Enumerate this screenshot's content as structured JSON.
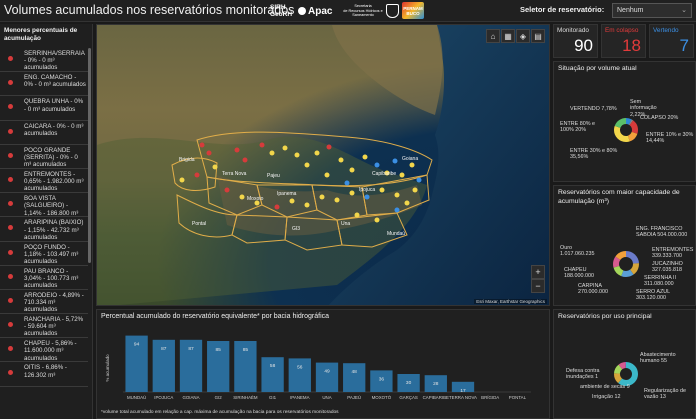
{
  "header": {
    "title": "Volumes acumulados nos reservatórios monitorados",
    "logo_sirh": [
      "SIRH",
      "GeoRH"
    ],
    "logo_apac": "Apac",
    "logo_sec": [
      "Secretaria",
      "de Recursos Hídricos e",
      "Saneamento"
    ],
    "logo_gov": [
      "PERNAM",
      "BUCO"
    ],
    "selector_label": "Seletor de reservatório:",
    "selector_value": "Nenhum"
  },
  "left_panel": {
    "title": "Menores percentuais de acumulação",
    "items": [
      "SERRINHA/SERRAIA - 0% - 0 m³ acumulados",
      "ENG. CAMACHO - 0% - 0 m³ acumulados",
      "QUEBRA UNHA - 0% - 0 m³ acumulados",
      "CAICARA - 0% - 0 m³ acumulados",
      "POCO GRANDE (SERRITA) - 0% - 0 m³ acumulados",
      "ENTREMONTES - 0,65% - 1.982.000 m³ acumulados",
      "BOA VISTA (SALGUEIRO) - 1,14% - 186.800 m³ acumulados",
      "ARARIPINA (BAIXIO) - 1,15% - 42.732 m³ acumulados",
      "POÇO FUNDO - 1,18% - 103.497 m³ acumulados",
      "PAU BRANCO - 3,04% - 100.773 m³ acumulados",
      "ARRODEIO - 4,89% - 710.334 m³ acumulados",
      "RANCHARIA - 5,72% - 59.604 m³ acumulados",
      "CHAPEU - 5,86% - 11.600.000 m³ acumulados",
      "OITIS - 6,86% - 126.302 m³"
    ]
  },
  "map": {
    "tools": [
      "home-icon",
      "grid-icon",
      "layers-icon",
      "basemap-icon"
    ],
    "zoom_in": "+",
    "zoom_out": "−",
    "attribution": "Esri Maxar, Earthstar Geographics",
    "basin_labels": [
      "Brigida",
      "Terra Nova",
      "Pajeu",
      "Moxoto",
      "Ipanema",
      "Ipojuca",
      "Capibaribe",
      "Una",
      "Mundaú",
      "Goiana",
      "Pontal",
      "GI3"
    ]
  },
  "kpis": [
    {
      "label": "Monitorado",
      "value": "90",
      "color": "#ffffff"
    },
    {
      "label": "Em colapso",
      "value": "18",
      "color": "#e33b3b"
    },
    {
      "label": "Vertendo",
      "value": "7",
      "color": "#3b8fe3"
    }
  ],
  "situacao": {
    "title": "Situação por volume atual",
    "labels": [
      "VERTENDO 7,78%",
      "Sem informação 2,22%",
      "COLAPSO 20%",
      "ENTRE 10% e 30% 14,44%",
      "ENTRE 30% e 80% 35,56%",
      "ENTRE 80% e 100% 20%"
    ]
  },
  "capacidade": {
    "title": "Reservatórios com maior capacidade de acumulação (m³)",
    "labels": [
      "ENG. FRANCISCO SABOIA 504.000.000",
      "ENTREMONTES 339.333.700",
      "JUCAZINHO 327.035.818",
      "SERRINHA II 311.080.000",
      "SERRO AZUL 303.120.000",
      "Ouro 1.017.060.235",
      "CHAPEU 188.000.000",
      "CARPINA 270.000.000"
    ]
  },
  "uso": {
    "title": "Reservatórios por uso principal",
    "labels": [
      "Abastecimento humano 55",
      "Defesa contra inundações 1",
      "Irrigação 12",
      "Regularização de vazão 13",
      "ambiente de secas 9"
    ]
  },
  "chart_data": {
    "type": "bar",
    "title": "Percentual acumulado do reservatório equivalente* por bacia hidrográfica",
    "ylabel": "% acumulado",
    "categories": [
      "MUNDAÚ",
      "IPOJUCA",
      "GOIANA",
      "GI2",
      "SIRINHAÉM",
      "GI1",
      "IPANEMA",
      "UNA",
      "PAJEÚ",
      "MOXOTÓ",
      "GARÇAS",
      "CAPIBARIBE",
      "TERRA NOVA",
      "BRÍGIDA",
      "PONTAL"
    ],
    "values": [
      94,
      87,
      87,
      85,
      85,
      58,
      56,
      49,
      48,
      36,
      30,
      28,
      17,
      0,
      0
    ],
    "value_labels": [
      "94",
      "87",
      "87",
      "85",
      "85",
      "58",
      "56",
      "49",
      "48",
      "36",
      "30",
      "28",
      "17",
      "",
      ""
    ],
    "ylim": [
      0,
      100
    ],
    "footnote": "*volume total acumulado em relação a cap. máxima de acumulação na bacia para os reservatórios monitorados",
    "color": "#2a6d9c"
  },
  "colors": {
    "accent_blue": "#2a6d9c",
    "alarm_red": "#e33b3b",
    "vertendo_blue": "#3b8fe3"
  }
}
